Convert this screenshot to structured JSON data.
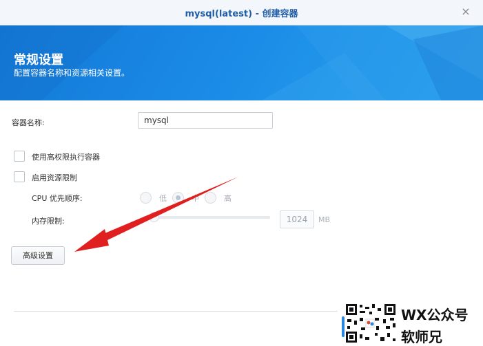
{
  "window": {
    "title": "mysql(latest) - 创建容器",
    "close_icon": "×"
  },
  "banner": {
    "title": "常规设置",
    "subtitle": "配置容器名称和资源相关设置。"
  },
  "form": {
    "container_name_label": "容器名称:",
    "container_name_value": "mysql",
    "privileged_label": "使用高权限执行容器",
    "privileged_checked": false,
    "resource_limit_label": "启用资源限制",
    "resource_limit_checked": false,
    "cpu_priority_label": "CPU 优先顺序:",
    "cpu_options": [
      "低",
      "中",
      "高"
    ],
    "cpu_selected": "中",
    "memory_limit_label": "内存限制:",
    "memory_value": "1024",
    "memory_unit": "MB",
    "advanced_button": "高级设置"
  },
  "watermark": {
    "line1": "WX公众号",
    "line2": "软师兄"
  },
  "colors": {
    "accent": "#1a8ae6",
    "title": "#1f5da8",
    "arrow": "#e02020"
  }
}
